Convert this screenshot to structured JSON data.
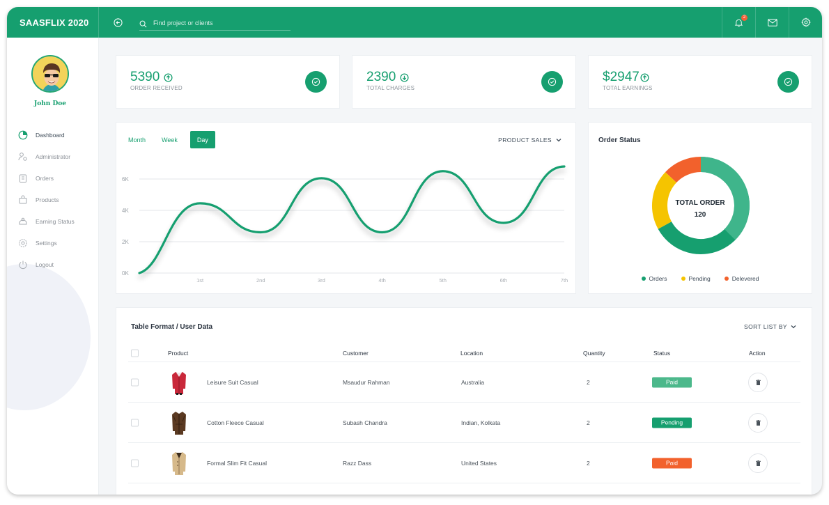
{
  "app": {
    "brand": "SAASFLIX 2020"
  },
  "search": {
    "placeholder": "Find project or clients"
  },
  "notifications": {
    "count": "2"
  },
  "user": {
    "name": "John Doe"
  },
  "sidebar": {
    "items": [
      {
        "label": "Dashboard",
        "icon": "dashboard-icon"
      },
      {
        "label": "Administrator",
        "icon": "admin-icon"
      },
      {
        "label": "Orders",
        "icon": "orders-icon"
      },
      {
        "label": "Products",
        "icon": "products-icon"
      },
      {
        "label": "Earning Status",
        "icon": "earning-icon"
      },
      {
        "label": "Settings",
        "icon": "settings-icon"
      },
      {
        "label": "Logout",
        "icon": "logout-icon"
      }
    ]
  },
  "stats": [
    {
      "value": "5390",
      "label": "ORDER RECEIVED",
      "arrow": "up"
    },
    {
      "value": "2390",
      "label": "TOTAL CHARGES",
      "arrow": "down"
    },
    {
      "value": "$2947",
      "label": "TOTAL EARNINGS",
      "arrow": "up"
    }
  ],
  "sales_chart": {
    "tabs": [
      "Month",
      "Week",
      "Day"
    ],
    "active_tab": "Day",
    "dropdown_label": "PRODUCT SALES"
  },
  "chart_data": {
    "type": "line",
    "title": "",
    "x": [
      "",
      "1st",
      "2nd",
      "3rd",
      "4th",
      "5th",
      "6th",
      "7th"
    ],
    "y_ticks": [
      "0K",
      "2K",
      "4K",
      "6K"
    ],
    "ylim": [
      0,
      6000
    ],
    "series": [
      {
        "values": [
          0,
          4450,
          2600,
          6050,
          2600,
          6500,
          3200,
          6800
        ]
      }
    ],
    "grid": true,
    "color": "#169f6f"
  },
  "order_status": {
    "title": "Order Status",
    "center_label": "TOTAL ORDER",
    "center_value": "120",
    "segments": [
      {
        "label": "Orders",
        "value": 67,
        "color": "#169f6f"
      },
      {
        "label": "Pending",
        "value": 20,
        "color": "#f5c400"
      },
      {
        "label": "Delevered",
        "value": 13,
        "color": "#f2612c"
      }
    ]
  },
  "table": {
    "title": "Table Format / User Data",
    "sort_label": "SORT LIST BY",
    "headers": [
      "Product",
      "Customer",
      "Location",
      "Quantity",
      "Status",
      "Action"
    ],
    "rows": [
      {
        "product": "Leisure Suit Casual",
        "customer": "Msaudur Rahman",
        "location": "Australia",
        "quantity": "2",
        "status": "Paid",
        "status_color": "#4cb88b",
        "image": "red-jacket"
      },
      {
        "product": "Cotton Fleece Casual",
        "customer": "Subash Chandra",
        "location": "Indian, Kolkata",
        "quantity": "2",
        "status": "Pending",
        "status_color": "#169f6f",
        "image": "brown-jacket"
      },
      {
        "product": "Formal Slim Fit Casual",
        "customer": "Razz Dass",
        "location": "United States",
        "quantity": "2",
        "status": "Paid",
        "status_color": "#f2612c",
        "image": "beige-jacket"
      }
    ]
  }
}
